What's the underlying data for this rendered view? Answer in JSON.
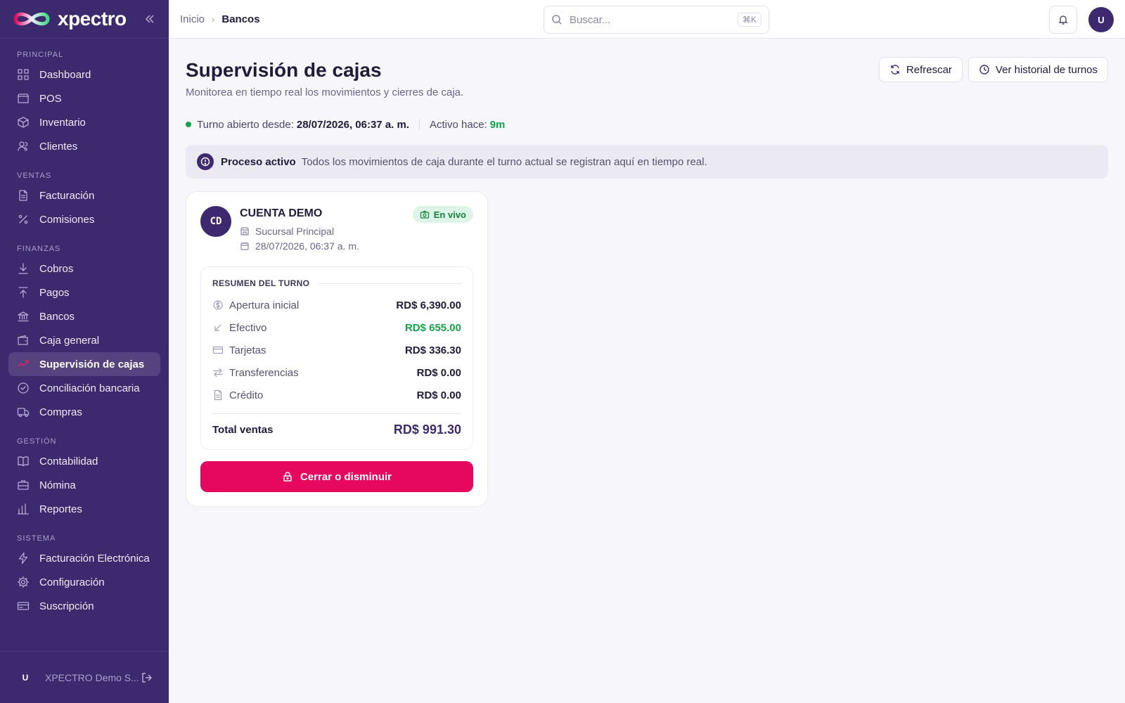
{
  "brand": {
    "name": "xpectro",
    "accent": "#e5085e",
    "primary": "#3d2a6e"
  },
  "sidebar": {
    "sections": [
      {
        "title": "PRINCIPAL",
        "items": [
          {
            "label": "Dashboard",
            "icon": "grid-icon"
          },
          {
            "label": "POS",
            "icon": "store-icon"
          },
          {
            "label": "Inventario",
            "icon": "box-icon"
          },
          {
            "label": "Clientes",
            "icon": "users-icon"
          }
        ]
      },
      {
        "title": "VENTAS",
        "items": [
          {
            "label": "Facturación",
            "icon": "file-icon"
          },
          {
            "label": "Comisiones",
            "icon": "percent-icon"
          }
        ]
      },
      {
        "title": "FINANZAS",
        "items": [
          {
            "label": "Cobros",
            "icon": "arrow-down-icon"
          },
          {
            "label": "Pagos",
            "icon": "arrow-up-icon"
          },
          {
            "label": "Bancos",
            "icon": "bank-icon"
          },
          {
            "label": "Caja general",
            "icon": "wallet-icon"
          },
          {
            "label": "Supervisión de cajas",
            "icon": "monitor-icon"
          },
          {
            "label": "Conciliación bancaria",
            "icon": "check-circle-icon"
          },
          {
            "label": "Compras",
            "icon": "truck-icon"
          }
        ]
      },
      {
        "title": "GESTIÓN",
        "items": [
          {
            "label": "Contabilidad",
            "icon": "book-icon"
          },
          {
            "label": "Nómina",
            "icon": "briefcase-icon"
          },
          {
            "label": "Reportes",
            "icon": "bar-chart-icon"
          }
        ]
      },
      {
        "title": "SISTEMA",
        "items": [
          {
            "label": "Facturación Electrónica",
            "icon": "bolt-icon"
          },
          {
            "label": "Configuración",
            "icon": "gear-icon"
          },
          {
            "label": "Suscripción",
            "icon": "card-icon"
          }
        ]
      }
    ],
    "footer": {
      "avatar_initial": "U",
      "name": "XPECTRO Demo S..."
    }
  },
  "header": {
    "breadcrumb_home": "Inicio",
    "breadcrumb_current": "Bancos",
    "search_placeholder": "Buscar...",
    "search_shortcut": "⌘K",
    "user_initial": "U"
  },
  "page": {
    "title": "Supervisión de cajas",
    "subtitle": "Monitorea en tiempo real los movimientos y cierres de caja.",
    "refresh_label": "Refrescar",
    "history_label": "Ver historial de turnos",
    "status": {
      "open_label": "Turno abierto desde:",
      "open_value": "28/07/2026, 06:37 a. m.",
      "active_label": "Activo hace:",
      "active_value": "9m"
    },
    "banner": {
      "title": "Proceso activo",
      "text": "Todos los movimientos de caja durante el turno actual se registran aquí en tiempo real."
    }
  },
  "card": {
    "initials": "CD",
    "account_name": "CUENTA DEMO",
    "badge": "En vivo",
    "branch": "Sucursal Principal",
    "date": "28/07/2026, 06:37 a. m.",
    "summary_title": "RESUMEN DEL TURNO",
    "rows": [
      {
        "label": "Apertura inicial",
        "value": "RD$ 6,390.00",
        "icon": "dollar-circle-icon"
      },
      {
        "label": "Efectivo",
        "value": "RD$ 655.00",
        "icon": "arrow-down-left-icon"
      },
      {
        "label": "Tarjetas",
        "value": "RD$ 336.30",
        "icon": "credit-card-icon"
      },
      {
        "label": "Transferencias",
        "value": "RD$ 0.00",
        "icon": "swap-icon"
      },
      {
        "label": "Crédito",
        "value": "RD$ 0.00",
        "icon": "document-icon"
      }
    ],
    "total_label": "Total ventas",
    "total_value": "RD$ 991.30",
    "close_button": "Cerrar o disminuir"
  }
}
